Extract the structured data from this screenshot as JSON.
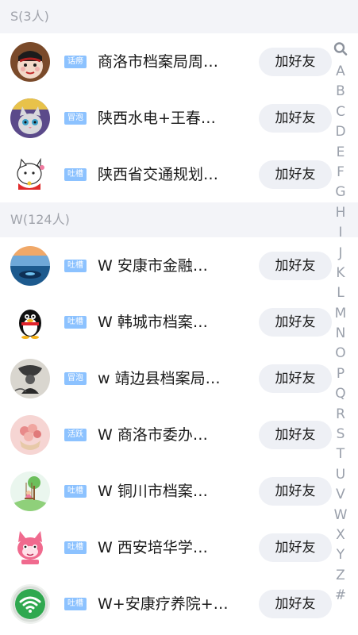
{
  "sections": [
    {
      "header": "S(3人)",
      "rows": [
        {
          "badge": "话痨",
          "name": "商洛市档案局周…",
          "button": "加好友",
          "avatar": "opera-face-avatar"
        },
        {
          "badge": "冒泡",
          "name": "陕西水电+王春…",
          "button": "加好友",
          "avatar": "cat-avatar"
        },
        {
          "badge": "吐槽",
          "name": "陕西省交通规划…",
          "button": "加好友",
          "avatar": "cartoon-cat-avatar"
        }
      ]
    },
    {
      "header": "W(124人)",
      "rows": [
        {
          "badge": "吐槽",
          "name": "W 安康市金融…",
          "button": "加好友",
          "avatar": "sunset-sea-avatar"
        },
        {
          "badge": "吐槽",
          "name": "W 韩城市档案…",
          "button": "加好友",
          "avatar": "penguin-avatar"
        },
        {
          "badge": "冒泡",
          "name": "w 靖边县档案局…",
          "button": "加好友",
          "avatar": "ink-painting-avatar"
        },
        {
          "badge": "活跃",
          "name": "W 商洛市委办…",
          "button": "加好友",
          "avatar": "flower-basket-avatar"
        },
        {
          "badge": "吐槽",
          "name": "W 铜川市档案…",
          "button": "加好友",
          "avatar": "swing-avatar"
        },
        {
          "badge": "吐槽",
          "name": "W 西安培华学…",
          "button": "加好友",
          "avatar": "pink-cartoon-avatar"
        },
        {
          "badge": "吐槽",
          "name": "W+安康疗养院+…",
          "button": "加好友",
          "avatar": "wifi-avatar"
        }
      ]
    }
  ],
  "index": {
    "search_icon": "search-icon",
    "letters": [
      "A",
      "B",
      "C",
      "D",
      "E",
      "F",
      "G",
      "H",
      "I",
      "J",
      "K",
      "L",
      "M",
      "N",
      "O",
      "P",
      "Q",
      "R",
      "S",
      "T",
      "U",
      "V",
      "W",
      "X",
      "Y",
      "Z",
      "#"
    ]
  },
  "colors": {
    "badge": "#8cc2ff",
    "button_bg": "#eef0f5",
    "section_bg": "#f3f4f8",
    "index_text": "#9aa0ab"
  }
}
